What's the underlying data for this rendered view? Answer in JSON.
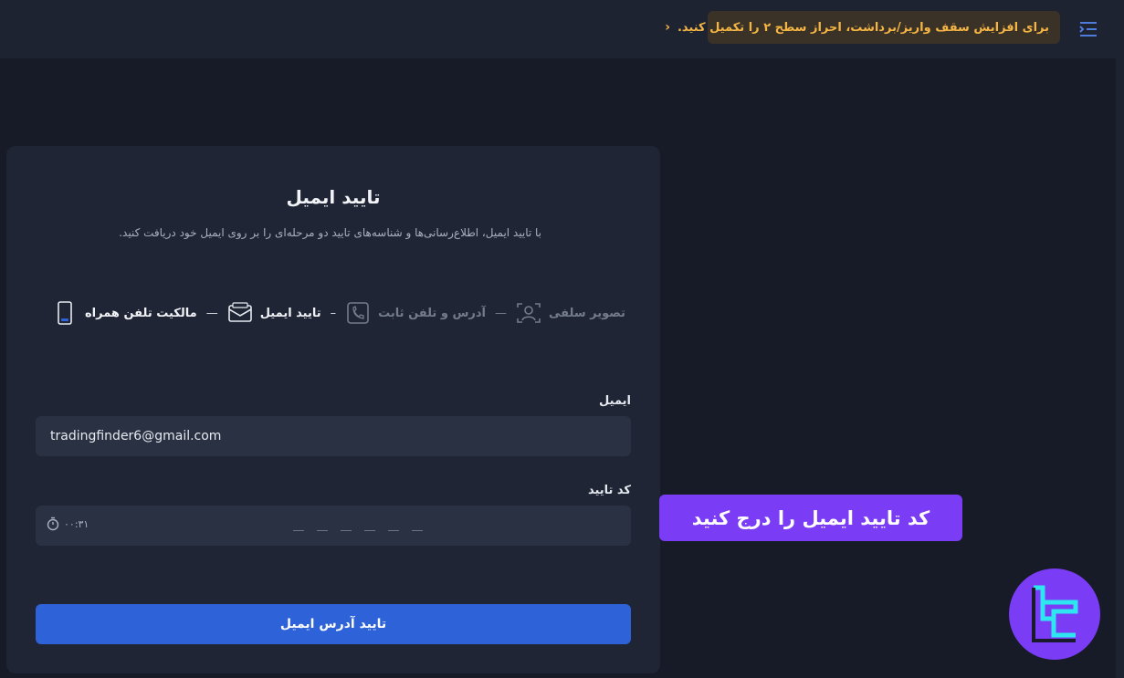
{
  "header": {
    "notice_text": "برای افزایش سقف واریز/برداشت، احراز سطح ۲ را تکمیل کنید.",
    "notice_chevron": "›",
    "menu_icon": "menu-collapse-icon"
  },
  "card": {
    "title": "تایید ایمیل",
    "subtitle": "با تایید ایمیل، اطلاع‌رسانی‌ها و شناسه‌های تایید دو مرحله‌ای را بر روی ایمیل خود دریافت کنید.",
    "steps": [
      {
        "label": "مالکیت تلفن همراه",
        "icon": "mobile-phone-icon",
        "state": "active"
      },
      {
        "label": "تایید ایمیل",
        "icon": "email-icon",
        "state": "active"
      },
      {
        "label": "آدرس و تلفن ثابت",
        "icon": "phone-address-icon",
        "state": "inactive"
      },
      {
        "label": "تصویر سلفی",
        "icon": "selfie-icon",
        "state": "inactive"
      }
    ],
    "email_label": "ایمیل",
    "email_value": "tradingfinder6@gmail.com",
    "code_label": "کد تایید",
    "timer_text": "۰۰:۳۱",
    "submit_label": "تایید آدرس ایمیل"
  },
  "overlay": {
    "label": "کد تایید ایمیل را درج کنید"
  },
  "colors": {
    "accent": "#2e62d9",
    "warning": "#f5b544",
    "overlay": "#7a3cf5"
  }
}
